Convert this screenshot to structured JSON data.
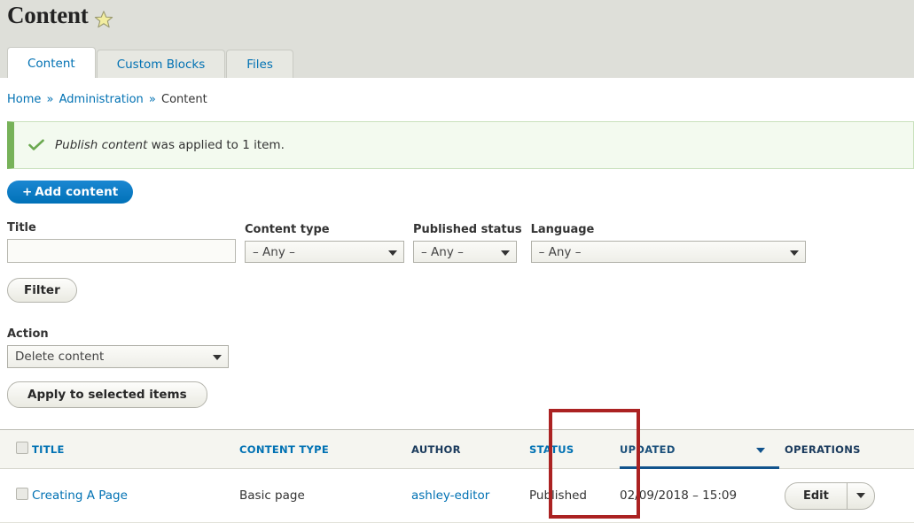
{
  "header": {
    "title": "Content",
    "favorite_icon": "star-icon"
  },
  "tabs": [
    {
      "label": "Content",
      "active": true
    },
    {
      "label": "Custom Blocks",
      "active": false
    },
    {
      "label": "Files",
      "active": false
    }
  ],
  "breadcrumb": {
    "items": [
      "Home",
      "Administration",
      "Content"
    ],
    "separator": "»"
  },
  "message": {
    "icon": "check-icon",
    "emphasis": "Publish content",
    "text": " was applied to 1 item."
  },
  "toolbar": {
    "add_content_label": "+ Add content"
  },
  "filters": {
    "title": {
      "label": "Title",
      "value": "",
      "placeholder": ""
    },
    "content_type": {
      "label": "Content type",
      "value": "– Any –"
    },
    "published_status": {
      "label": "Published status",
      "value": "– Any –"
    },
    "language": {
      "label": "Language",
      "value": "– Any –"
    },
    "filter_button": "Filter"
  },
  "action": {
    "label": "Action",
    "selected": "Delete content",
    "apply_button": "Apply to selected items"
  },
  "table": {
    "columns": [
      {
        "label": "",
        "name": "select-all"
      },
      {
        "label": "TITLE",
        "name": "title",
        "link": true
      },
      {
        "label": "CONTENT TYPE",
        "name": "content-type",
        "link": true
      },
      {
        "label": "AUTHOR",
        "name": "author",
        "link": false
      },
      {
        "label": "STATUS",
        "name": "status",
        "link": true
      },
      {
        "label": "UPDATED",
        "name": "updated",
        "link": true,
        "sorted": true
      },
      {
        "label": "OPERATIONS",
        "name": "operations",
        "link": false
      }
    ],
    "rows": [
      {
        "title": "Creating A Page",
        "content_type": "Basic page",
        "author": "ashley-editor",
        "status": "Published",
        "updated": "02/09/2018 – 15:09",
        "operations": {
          "primary": "Edit",
          "toggle": "chevron-down-icon"
        }
      }
    ]
  },
  "annotation": {
    "highlight_column": "STATUS",
    "color": "#ab2222"
  }
}
